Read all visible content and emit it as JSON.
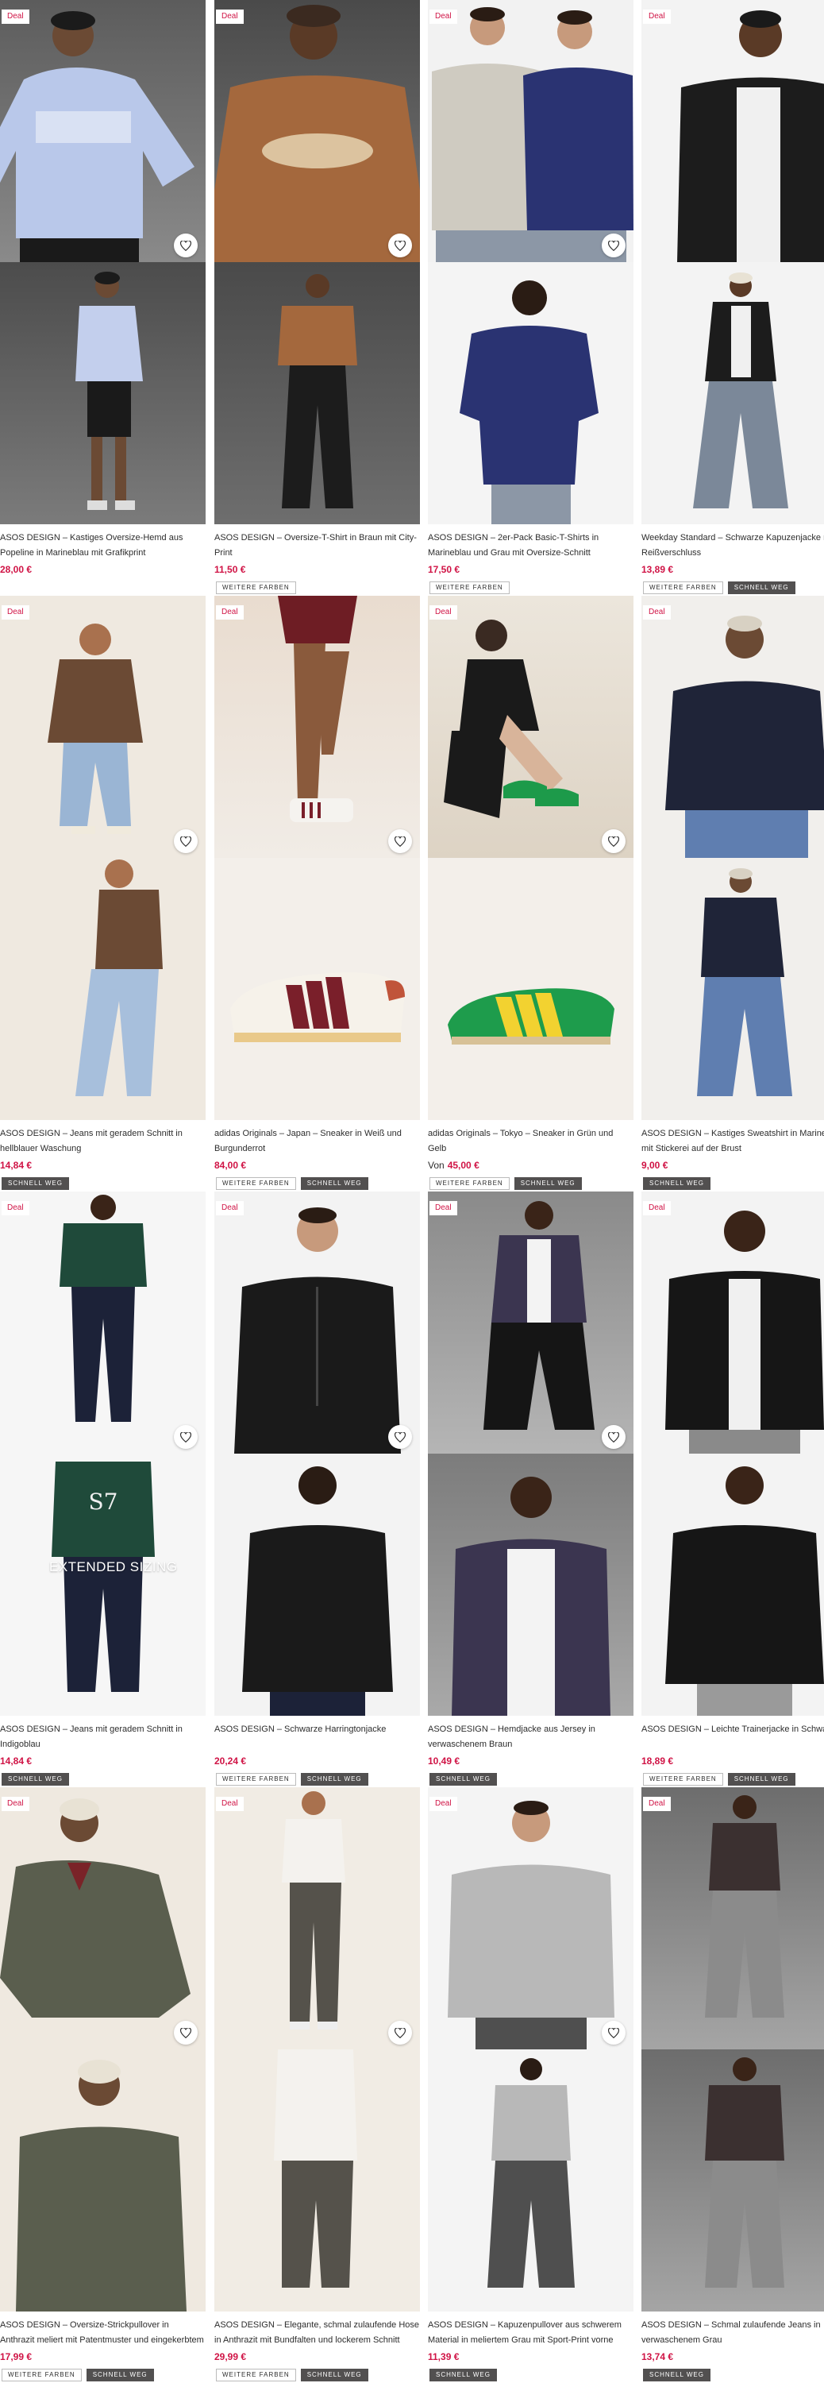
{
  "labels": {
    "deal": "Deal",
    "more_colors": "WEITERE FARBEN",
    "quick_ship": "SCHNELL WEG",
    "from": "Von"
  },
  "colors": {
    "price": "#d01345",
    "deal_text": "#d01345",
    "quick_ship_bg": "#525050"
  },
  "products": [
    {
      "name": "ASOS DESIGN – Kastiges Oversize-Hemd aus\nPopeline in Marineblau mit Grafikprint",
      "price": "28,00 €",
      "deal": true,
      "more_colors": false,
      "quick_ship": false
    },
    {
      "name": "ASOS DESIGN – Oversize-T-Shirt in Braun mit City-\nPrint",
      "price": "11,50 €",
      "deal": true,
      "more_colors": true,
      "quick_ship": false
    },
    {
      "name": "ASOS DESIGN – 2er-Pack Basic-T-Shirts in\nMarineblau und Grau mit Oversize-Schnitt",
      "price": "17,50 €",
      "deal": true,
      "more_colors": true,
      "quick_ship": false
    },
    {
      "name": "Weekday Standard – Schwarze Kapuzenjacke mit\nReißverschluss",
      "price": "13,89 €",
      "deal": true,
      "more_colors": true,
      "quick_ship": true
    },
    {
      "name": "ASOS DESIGN – Jeans mit geradem Schnitt in\nhellblauer Waschung",
      "price": "14,84 €",
      "deal": true,
      "more_colors": false,
      "quick_ship": true
    },
    {
      "name": "adidas Originals – Japan – Sneaker in Weiß und\nBurgunderrot",
      "price": "84,00 €",
      "deal": true,
      "more_colors": true,
      "quick_ship": true
    },
    {
      "name": "adidas Originals – Tokyo – Sneaker in Grün und\nGelb",
      "price": "45,00 €",
      "price_from": true,
      "deal": true,
      "more_colors": true,
      "quick_ship": true
    },
    {
      "name": "ASOS DESIGN – Kastiges Sweatshirt in Marineblau\nmit Stickerei auf der Brust",
      "price": "9,00 €",
      "deal": true,
      "more_colors": false,
      "quick_ship": true
    },
    {
      "name": "ASOS DESIGN – Jeans mit geradem Schnitt in\nIndigoblau",
      "price": "14,84 €",
      "deal": true,
      "more_colors": false,
      "quick_ship": true,
      "overlay": "EXTENDED SIZING"
    },
    {
      "name": "ASOS DESIGN – Schwarze Harringtonjacke",
      "price": "20,24 €",
      "deal": true,
      "more_colors": true,
      "quick_ship": true
    },
    {
      "name": "ASOS DESIGN – Hemdjacke aus Jersey in\nverwaschenem Braun",
      "price": "10,49 €",
      "deal": true,
      "more_colors": false,
      "quick_ship": true
    },
    {
      "name": "ASOS DESIGN – Leichte Trainerjacke in Schwarz",
      "price": "18,89 €",
      "deal": true,
      "more_colors": true,
      "quick_ship": true
    },
    {
      "name": "ASOS DESIGN – Oversize-Strickpullover in\nAnthrazit meliert mit Patentmuster und eingekerbtem",
      "price": "17,99 €",
      "deal": true,
      "more_colors": true,
      "quick_ship": true
    },
    {
      "name": "ASOS DESIGN – Elegante, schmal zulaufende Hose\nin Anthrazit mit Bundfalten und lockerem Schnitt",
      "price": "29,99 €",
      "deal": true,
      "more_colors": true,
      "quick_ship": true
    },
    {
      "name": "ASOS DESIGN – Kapuzenpullover aus schwerem\nMaterial in meliertem Grau mit Sport-Print vorne",
      "price": "11,39 €",
      "deal": true,
      "more_colors": false,
      "quick_ship": true
    },
    {
      "name": "ASOS DESIGN – Schmal zulaufende Jeans in\nverwaschenem Grau",
      "price": "13,74 €",
      "deal": true,
      "more_colors": false,
      "quick_ship": true
    }
  ]
}
